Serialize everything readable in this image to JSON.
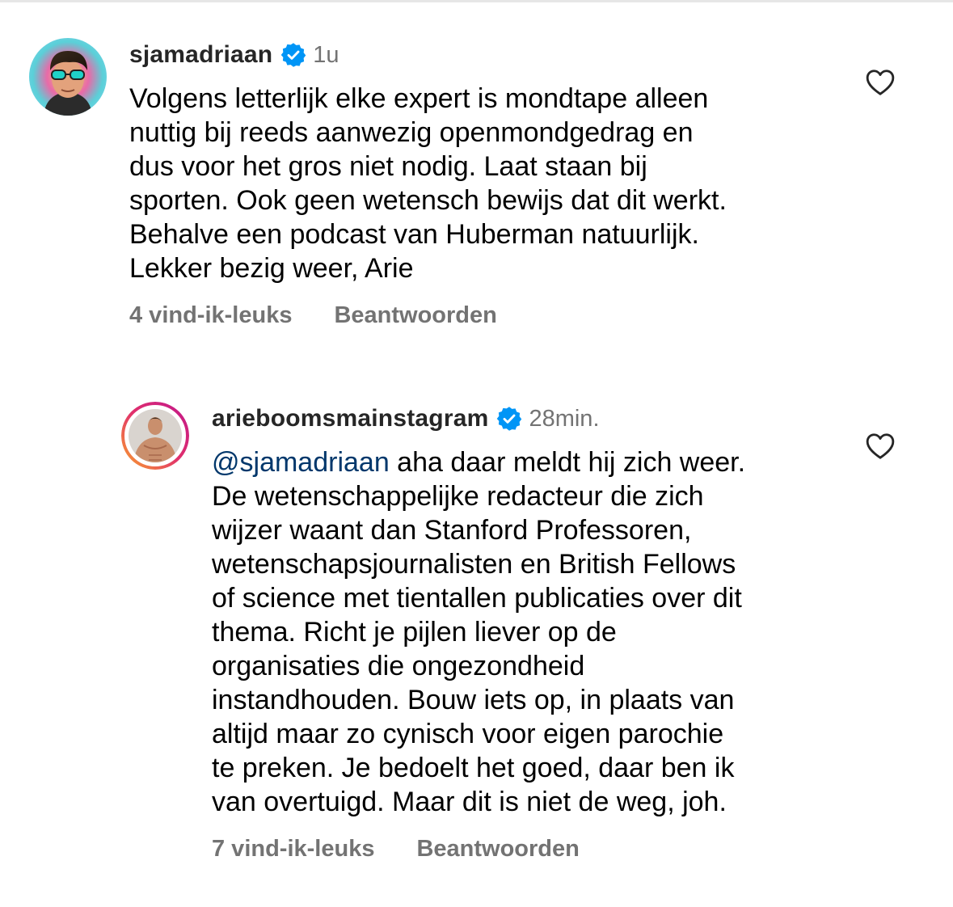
{
  "comments": [
    {
      "username": "sjamadriaan",
      "verified": true,
      "time": "1u",
      "text": "Volgens letterlijk elke expert is mondtape alleen\nnuttig bij reeds aanwezig openmondgedrag en\ndus voor het gros niet nodig. Laat staan bij\nsporten. Ook geen wetensch bewijs dat dit werkt.\nBehalve een podcast van Huberman natuurlijk.\nLekker bezig weer, Arie",
      "likes": "4 vind-ik-leuks",
      "reply_label": "Beantwoorden"
    },
    {
      "username": "arieboomsmainstagram",
      "verified": true,
      "time": "28min.",
      "mention": "@sjamadriaan",
      "text": " aha daar meldt hij zich weer.\nDe wetenschappelijke redacteur die zich\nwijzer waant dan Stanford Professoren,\nwetenschapsjournalisten en British Fellows\nof science met tientallen publicaties over dit\nthema. Richt je pijlen liever op de\norganisaties die ongezondheid\ninstandhouden. Bouw iets op, in plaats van\naltijd maar zo cynisch voor eigen parochie\nte preken. Je bedoelt het goed, daar ben ik\nvan overtuigd. Maar dit is niet de weg, joh.",
      "likes": "7 vind-ik-leuks",
      "reply_label": "Beantwoorden"
    }
  ],
  "icons": {
    "verified": "verified-badge-icon",
    "like": "heart-outline-icon"
  },
  "colors": {
    "verified_blue": "#0095f6",
    "mention": "#00376b",
    "secondary_text": "#737373",
    "story_ring_start": "#f9a12e",
    "story_ring_end": "#c2188b"
  }
}
